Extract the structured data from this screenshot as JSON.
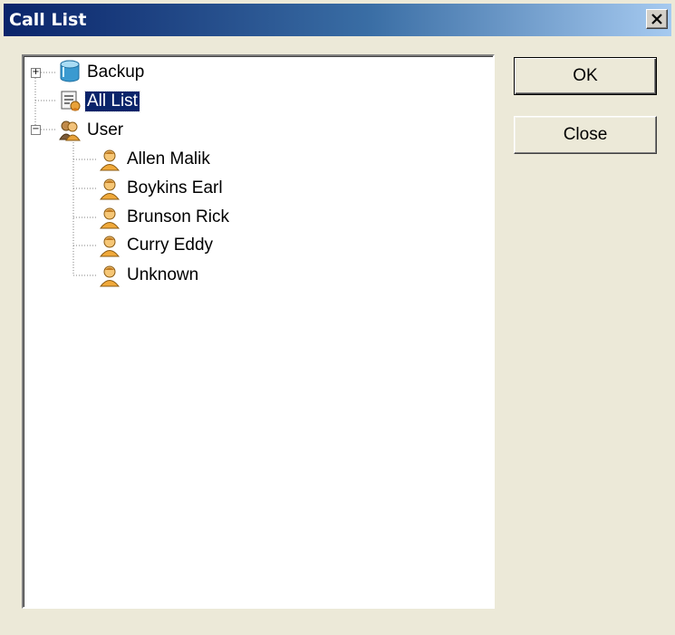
{
  "window": {
    "title": "Call List"
  },
  "buttons": {
    "ok_label": "OK",
    "close_label": "Close"
  },
  "tree": {
    "nodes": [
      {
        "label": "Backup",
        "icon": "database-icon",
        "expander": "+",
        "selected": false
      },
      {
        "label": "All List",
        "icon": "list-icon",
        "expander": "",
        "selected": true
      },
      {
        "label": "User",
        "icon": "user-group-icon",
        "expander": "−",
        "selected": false
      },
      {
        "label": "Allen Malik",
        "icon": "user-icon",
        "expander": "",
        "selected": false
      },
      {
        "label": "Boykins Earl",
        "icon": "user-icon",
        "expander": "",
        "selected": false
      },
      {
        "label": "Brunson Rick",
        "icon": "user-icon",
        "expander": "",
        "selected": false
      },
      {
        "label": "Curry Eddy",
        "icon": "user-icon",
        "expander": "",
        "selected": false
      },
      {
        "label": "Unknown",
        "icon": "user-icon",
        "expander": "",
        "selected": false
      }
    ]
  },
  "colors": {
    "title_start": "#0a246a",
    "title_end": "#a6caf0",
    "selection": "#0a246a",
    "face": "#ece9d8"
  }
}
